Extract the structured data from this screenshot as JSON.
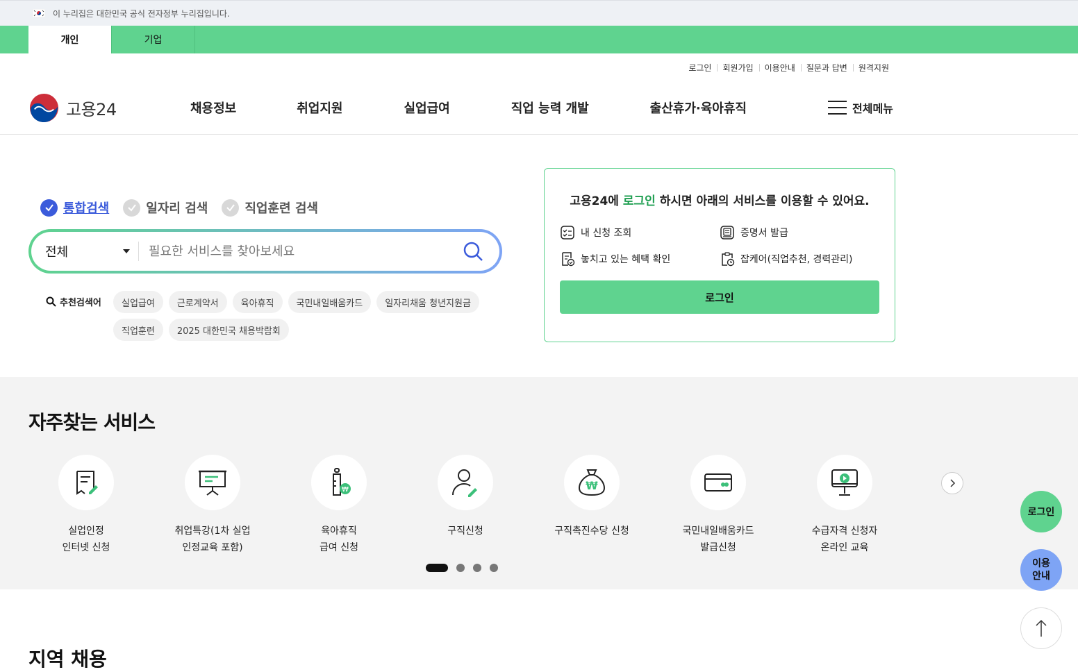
{
  "gov_banner": {
    "text": "이 누리집은 대한민국 공식 전자정부 누리집입니다."
  },
  "top_tabs": [
    {
      "label": "개인"
    },
    {
      "label": "기업"
    }
  ],
  "util_links": [
    {
      "label": "로그인"
    },
    {
      "label": "회원가입"
    },
    {
      "label": "이용안내"
    },
    {
      "label": "질문과 답변"
    },
    {
      "label": "원격지원"
    }
  ],
  "header": {
    "logo_text": "고용24",
    "nav": [
      {
        "label": "채용정보"
      },
      {
        "label": "취업지원"
      },
      {
        "label": "실업급여"
      },
      {
        "label": "직업 능력 개발"
      },
      {
        "label": "출산휴가·육아휴직"
      }
    ],
    "all_menu": "전체메뉴"
  },
  "search": {
    "tabs": [
      {
        "label": "통합검색"
      },
      {
        "label": "일자리 검색"
      },
      {
        "label": "직업훈련 검색"
      }
    ],
    "scope": "전체",
    "placeholder": "필요한 서비스를 찾아보세요",
    "rec_label": "추천검색어",
    "tags": [
      {
        "label": "실업급여"
      },
      {
        "label": "근로계약서"
      },
      {
        "label": "육아휴직"
      },
      {
        "label": "국민내일배움카드"
      },
      {
        "label": "일자리채움 청년지원금"
      },
      {
        "label": "직업훈련"
      },
      {
        "label": "2025 대한민국 채용박람회"
      }
    ]
  },
  "login_card": {
    "title_pre": "고용24에 ",
    "title_highlight": "로그인",
    "title_post": " 하시면 아래의 서비스를 이용할 수 있어요.",
    "services": [
      {
        "label": "내 신청 조회",
        "icon": "list-check-icon"
      },
      {
        "label": "증명서 발급",
        "icon": "certificate-icon"
      },
      {
        "label": "놓치고 있는 혜택 확인",
        "icon": "benefit-doc-icon"
      },
      {
        "label": "잡케어(직업추천, 경력관리)",
        "icon": "clipboard-clock-icon"
      }
    ],
    "button": "로그인"
  },
  "frequent": {
    "title": "자주찾는 서비스",
    "items": [
      {
        "label": "실업인정\n인터넷 신청",
        "icon": "document-pen-icon"
      },
      {
        "label": "취업특강(1차 실업\n인정교육 포함)",
        "icon": "presentation-board-icon"
      },
      {
        "label": "육아휴직\n급여 신청",
        "icon": "baby-bottle-won-icon"
      },
      {
        "label": "구직신청",
        "icon": "person-pen-icon"
      },
      {
        "label": "구직촉진수당 신청",
        "icon": "money-bag-won-icon"
      },
      {
        "label": "국민내일배움카드\n발급신청",
        "icon": "card-icon"
      },
      {
        "label": "수급자격 신청자\n온라인 교육",
        "icon": "monitor-play-icon"
      }
    ],
    "page_count": 4,
    "active_page": 1
  },
  "next_section_title": "지역 채용",
  "floating": {
    "login": "로그인",
    "guide": "이용\n안내"
  },
  "colors": {
    "brand_green": "#5fd38f",
    "accent_blue": "#3b5bdb",
    "guide_blue": "#7ea4f5"
  }
}
